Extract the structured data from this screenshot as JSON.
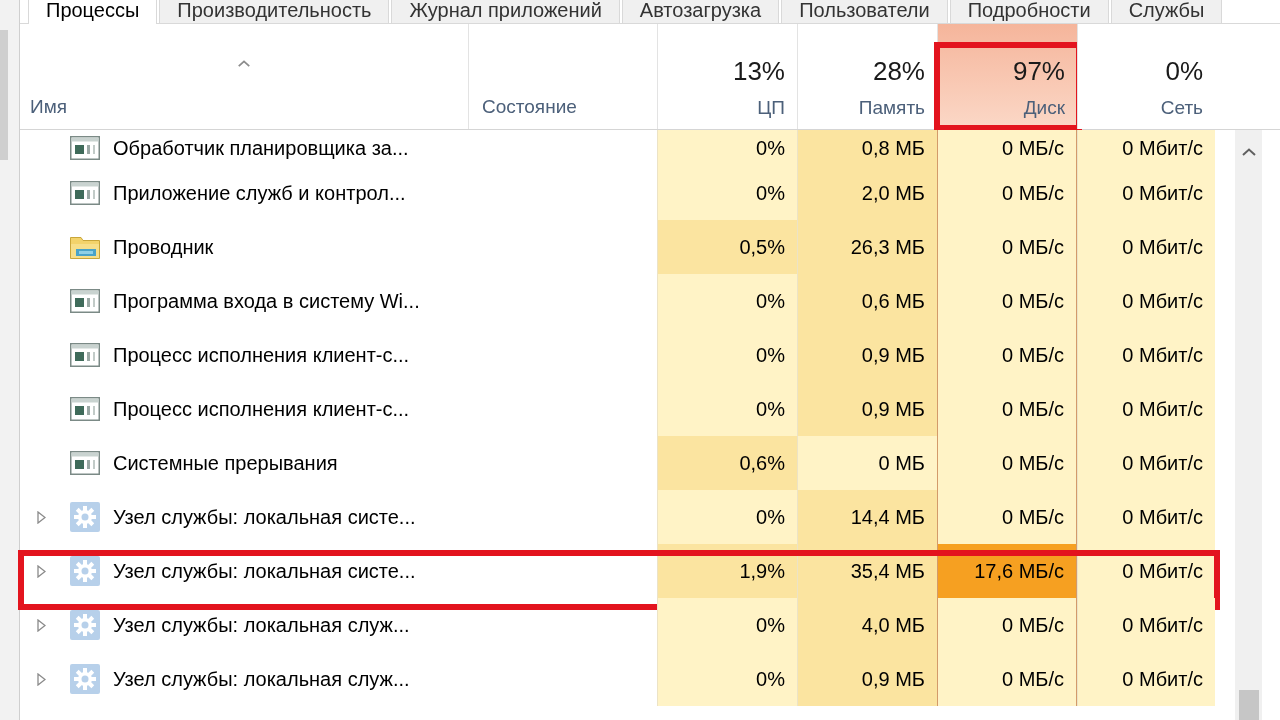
{
  "tabs": [
    {
      "label": "Процессы",
      "selected": true
    },
    {
      "label": "Производительность",
      "selected": false
    },
    {
      "label": "Журнал приложений",
      "selected": false
    },
    {
      "label": "Автозагрузка",
      "selected": false
    },
    {
      "label": "Пользователи",
      "selected": false
    },
    {
      "label": "Подробности",
      "selected": false
    },
    {
      "label": "Службы",
      "selected": false
    }
  ],
  "table": {
    "columns": [
      {
        "kind": "text",
        "label": "Имя",
        "sorted": true
      },
      {
        "kind": "text",
        "label": "Состояние",
        "sorted": false
      },
      {
        "kind": "metric",
        "total": "13%",
        "label": "ЦП",
        "alert": false,
        "highlighted": false
      },
      {
        "kind": "metric",
        "total": "28%",
        "label": "Память",
        "alert": false,
        "highlighted": false
      },
      {
        "kind": "metric",
        "total": "97%",
        "label": "Диск",
        "alert": true,
        "highlighted": true
      },
      {
        "kind": "metric",
        "total": "0%",
        "label": "Сеть",
        "alert": false,
        "highlighted": false
      }
    ],
    "rows": [
      {
        "name": "Обработчик планировщика за...",
        "kind": "window",
        "expandable": false,
        "highlighted": false,
        "values": [
          {
            "text": "0%",
            "color": "#fff3c6"
          },
          {
            "text": "0,8 МБ",
            "color": "#fbe4a0"
          },
          {
            "text": "0 МБ/с",
            "color": "#fff3c6"
          },
          {
            "text": "0 Мбит/с",
            "color": "#fff3c6"
          }
        ]
      },
      {
        "name": "Приложение служб и контрол...",
        "kind": "window",
        "expandable": false,
        "highlighted": false,
        "values": [
          {
            "text": "0%",
            "color": "#fff3c6"
          },
          {
            "text": "2,0 МБ",
            "color": "#fbe4a0"
          },
          {
            "text": "0 МБ/с",
            "color": "#fff3c6"
          },
          {
            "text": "0 Мбит/с",
            "color": "#fff3c6"
          }
        ]
      },
      {
        "name": "Проводник",
        "kind": "folder",
        "expandable": false,
        "highlighted": false,
        "values": [
          {
            "text": "0,5%",
            "color": "#fbe4a0"
          },
          {
            "text": "26,3 МБ",
            "color": "#fbe4a0"
          },
          {
            "text": "0 МБ/с",
            "color": "#fff3c6"
          },
          {
            "text": "0 Мбит/с",
            "color": "#fff3c6"
          }
        ]
      },
      {
        "name": "Программа входа в систему Wi...",
        "kind": "window",
        "expandable": false,
        "highlighted": false,
        "values": [
          {
            "text": "0%",
            "color": "#fff3c6"
          },
          {
            "text": "0,6 МБ",
            "color": "#fbe4a0"
          },
          {
            "text": "0 МБ/с",
            "color": "#fff3c6"
          },
          {
            "text": "0 Мбит/с",
            "color": "#fff3c6"
          }
        ]
      },
      {
        "name": "Процесс исполнения клиент-с...",
        "kind": "window",
        "expandable": false,
        "highlighted": false,
        "values": [
          {
            "text": "0%",
            "color": "#fff3c6"
          },
          {
            "text": "0,9 МБ",
            "color": "#fbe4a0"
          },
          {
            "text": "0 МБ/с",
            "color": "#fff3c6"
          },
          {
            "text": "0 Мбит/с",
            "color": "#fff3c6"
          }
        ]
      },
      {
        "name": "Процесс исполнения клиент-с...",
        "kind": "window",
        "expandable": false,
        "highlighted": false,
        "values": [
          {
            "text": "0%",
            "color": "#fff3c6"
          },
          {
            "text": "0,9 МБ",
            "color": "#fbe4a0"
          },
          {
            "text": "0 МБ/с",
            "color": "#fff3c6"
          },
          {
            "text": "0 Мбит/с",
            "color": "#fff3c6"
          }
        ]
      },
      {
        "name": "Системные прерывания",
        "kind": "window",
        "expandable": false,
        "highlighted": false,
        "values": [
          {
            "text": "0,6%",
            "color": "#fbe4a0"
          },
          {
            "text": "0 МБ",
            "color": "#fff3c6"
          },
          {
            "text": "0 МБ/с",
            "color": "#fff3c6"
          },
          {
            "text": "0 Мбит/с",
            "color": "#fff3c6"
          }
        ]
      },
      {
        "name": "Узел службы: локальная систе...",
        "kind": "service",
        "expandable": true,
        "highlighted": false,
        "values": [
          {
            "text": "0%",
            "color": "#fff3c6"
          },
          {
            "text": "14,4 МБ",
            "color": "#fbe4a0"
          },
          {
            "text": "0 МБ/с",
            "color": "#fff3c6"
          },
          {
            "text": "0 Мбит/с",
            "color": "#fff3c6"
          }
        ]
      },
      {
        "name": "Узел службы: локальная систе...",
        "kind": "service",
        "expandable": true,
        "highlighted": true,
        "values": [
          {
            "text": "1,9%",
            "color": "#fbe4a0"
          },
          {
            "text": "35,4 МБ",
            "color": "#fbe4a0"
          },
          {
            "text": "17,6 МБ/с",
            "color": "#f6a021"
          },
          {
            "text": "0 Мбит/с",
            "color": "#fff3c6"
          }
        ]
      },
      {
        "name": "Узел службы: локальная служ...",
        "kind": "service",
        "expandable": true,
        "highlighted": false,
        "values": [
          {
            "text": "0%",
            "color": "#fff3c6"
          },
          {
            "text": "4,0 МБ",
            "color": "#fbe4a0"
          },
          {
            "text": "0 МБ/с",
            "color": "#fff3c6"
          },
          {
            "text": "0 Мбит/с",
            "color": "#fff3c6"
          }
        ]
      },
      {
        "name": "Узел службы: локальная служ...",
        "kind": "service",
        "expandable": true,
        "highlighted": false,
        "values": [
          {
            "text": "0%",
            "color": "#fff3c6"
          },
          {
            "text": "0,9 МБ",
            "color": "#fbe4a0"
          },
          {
            "text": "0 МБ/с",
            "color": "#fff3c6"
          },
          {
            "text": "0 Мбит/с",
            "color": "#fff3c6"
          }
        ]
      }
    ]
  }
}
